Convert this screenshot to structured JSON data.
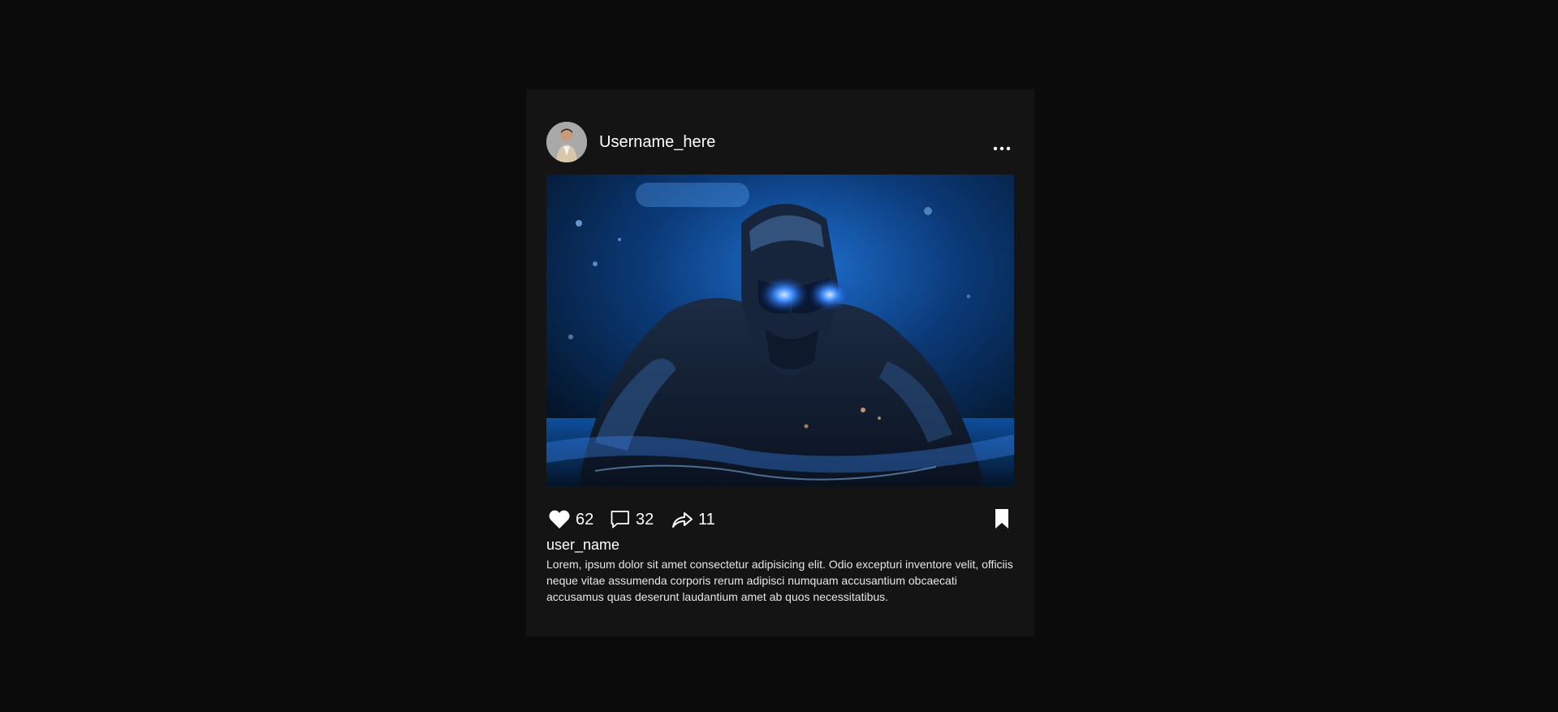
{
  "post": {
    "header": {
      "username": "Username_here",
      "avatar_icon": "person-avatar",
      "more_icon": "more-horizontal-icon"
    },
    "image_alt": "robot-in-water-illustration",
    "actions": {
      "like_count": "62",
      "comment_count": "32",
      "share_count": "11",
      "like_icon": "heart-icon",
      "comment_icon": "comment-icon",
      "share_icon": "share-icon",
      "bookmark_icon": "bookmark-icon"
    },
    "caption": {
      "username": "user_name",
      "text": "Lorem, ipsum dolor sit amet consectetur adipisicing elit. Odio excepturi inventore velit, officiis neque vitae assumenda corporis rerum adipisci numquam accusantium obcaecati accusamus quas deserunt laudantium amet ab quos necessitatibus."
    }
  },
  "colors": {
    "page_background": "#0b0b0b",
    "card_background": "#141414",
    "text": "#ffffff",
    "accent_glow": "#2f7dff"
  }
}
